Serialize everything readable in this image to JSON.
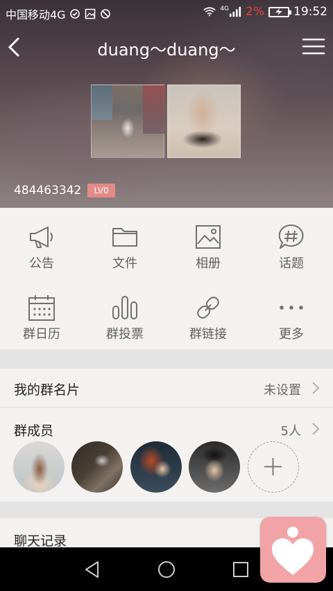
{
  "status_bar": {
    "carrier": "中国移动4G",
    "network_label": "4G",
    "battery_percent": "2%",
    "time": "19:52"
  },
  "nav": {
    "title": "duang～duang～"
  },
  "group": {
    "id": "484463342",
    "level": "LV0"
  },
  "grid": [
    {
      "label": "公告",
      "icon": "megaphone-icon"
    },
    {
      "label": "文件",
      "icon": "folder-icon"
    },
    {
      "label": "相册",
      "icon": "album-icon"
    },
    {
      "label": "话题",
      "icon": "topic-icon"
    },
    {
      "label": "群日历",
      "icon": "calendar-icon"
    },
    {
      "label": "群投票",
      "icon": "vote-icon"
    },
    {
      "label": "群链接",
      "icon": "link-icon"
    },
    {
      "label": "更多",
      "icon": "more-icon"
    }
  ],
  "my_card": {
    "label": "我的群名片",
    "value": "未设置"
  },
  "members": {
    "label": "群成员",
    "count": "5人"
  },
  "chat_history": {
    "label": "聊天记录"
  },
  "colors": {
    "badge": "#e58a86",
    "battery_low": "#e0433e",
    "fab": "#f2a3a6"
  }
}
